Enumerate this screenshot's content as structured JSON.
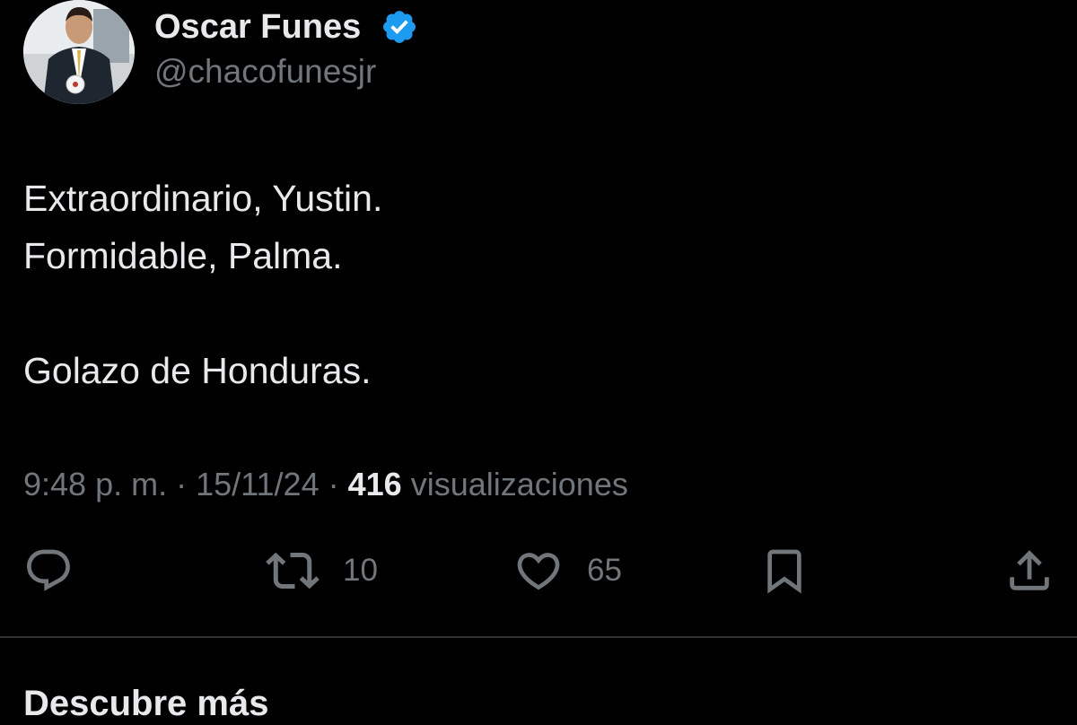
{
  "tweet": {
    "author_name": "Oscar Funes",
    "author_handle": "@chacofunesjr",
    "verified": true,
    "lines": [
      "Extraordinario, Yustin.",
      "Formidable, Palma.",
      "",
      "Golazo de Honduras."
    ],
    "time": "9:48 p. m.",
    "separator": "·",
    "date": "15/11/24",
    "views_count": "416",
    "views_label": "visualizaciones"
  },
  "actions": {
    "reply": {
      "icon": "reply-icon",
      "count": ""
    },
    "repost": {
      "icon": "repost-icon",
      "count": "10"
    },
    "like": {
      "icon": "heart-icon",
      "count": "65"
    },
    "bookmark": {
      "icon": "bookmark-icon",
      "count": ""
    },
    "share": {
      "icon": "share-icon",
      "count": ""
    }
  },
  "section": {
    "title": "Descubre más"
  },
  "colors": {
    "background": "#000000",
    "primary_text": "#e7e9ea",
    "secondary_text": "#71767b",
    "verified_blue": "#1d9bf0",
    "divider": "#2f3336"
  }
}
